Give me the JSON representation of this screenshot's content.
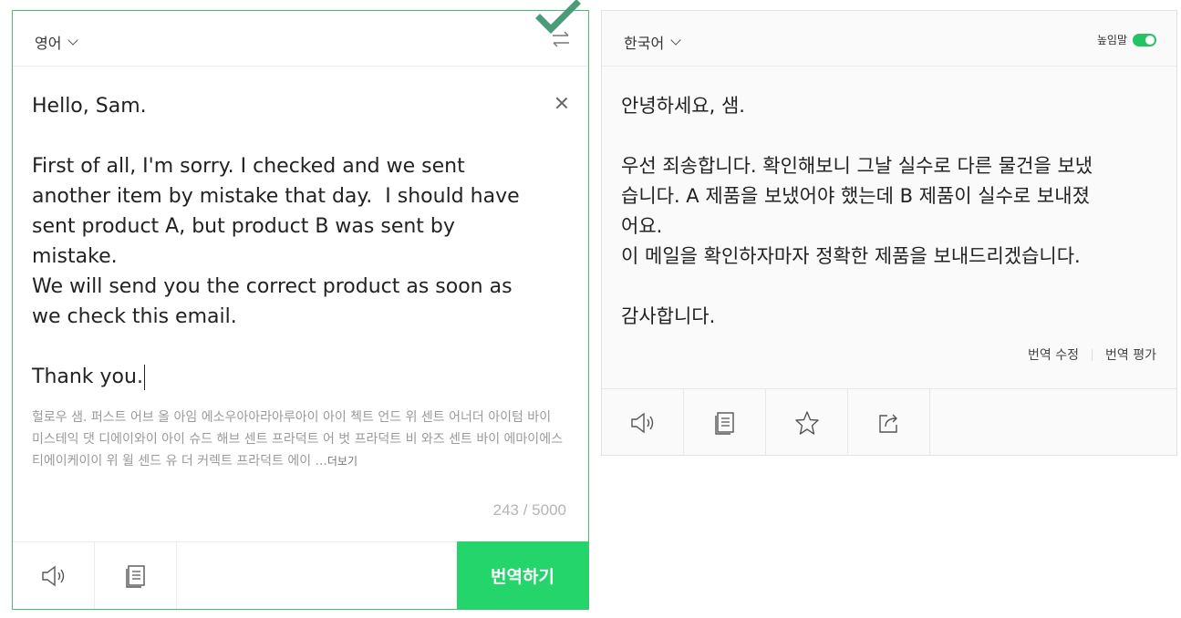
{
  "source": {
    "language": "영어",
    "text_lines": [
      "Hello, Sam.",
      "",
      "First of all, I'm sorry. I checked and we sent",
      "another item by mistake that day.  I should have",
      "sent product A, but product B was sent by",
      "mistake.",
      "We will send you the correct product as soon as",
      "we check this email.",
      "",
      "Thank you."
    ],
    "pronunciation": "헐로우 샘. 퍼스트 어브 올 아임 에소우아아라아루아이 아이 첵트 언드 위 센트 어너더 아이텀 바이 미스테익 댓 디에이와이 아이 슈드 해브 센트 프라덕트 어 벗 프라덕트 비 와즈 센트 바이 에마이에스티에이케이이 위 윌 센드 유 더 커렉트 프라덕트 에이 ...",
    "more_label": "더보기",
    "char_count": "243 / 5000",
    "translate_button": "번역하기"
  },
  "target": {
    "language": "한국어",
    "honorific_label": "높임말",
    "honorific_on": true,
    "text_lines": [
      "안녕하세요, 샘.",
      "",
      "우선 죄송합니다. 확인해보니 그날 실수로 다른 물건을 보냈",
      "습니다. A 제품을 보냈어야 했는데 B 제품이 실수로 보내졌",
      "어요.",
      "이 메일을 확인하자마자 정확한 제품을 보내드리겠습니다.",
      "",
      "감사합니다."
    ],
    "edit_label": "번역 수정",
    "rate_label": "번역 평가"
  },
  "icons": {
    "speaker": "speaker-icon",
    "notebook": "notebook-icon",
    "star": "star-icon",
    "share": "share-icon",
    "swap": "swap-icon",
    "clear": "close-icon",
    "check": "check-icon"
  },
  "colors": {
    "accent_green": "#24d56b",
    "border_green": "#41c46d",
    "toggle_green": "#24c463",
    "check_green": "#4c9b78"
  }
}
